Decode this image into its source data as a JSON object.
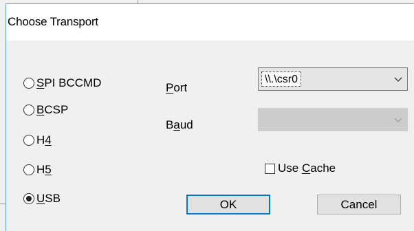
{
  "window": {
    "title": "Choose Transport"
  },
  "transport": {
    "options": [
      {
        "prefix": "",
        "accel": "S",
        "rest": "PI BCCMD",
        "checked": false
      },
      {
        "prefix": "",
        "accel": "B",
        "rest": "CSP",
        "checked": false
      },
      {
        "prefix": "H",
        "accel": "4",
        "rest": "",
        "checked": false
      },
      {
        "prefix": "H",
        "accel": "5",
        "rest": "",
        "checked": false
      },
      {
        "prefix": "",
        "accel": "U",
        "rest": "SB",
        "checked": true
      }
    ]
  },
  "port": {
    "label_accel": "P",
    "label_rest": "ort",
    "value": "\\\\.\\csr0"
  },
  "baud": {
    "label_pre": "B",
    "label_accel": "a",
    "label_rest": "ud",
    "value": ""
  },
  "use_cache": {
    "label_pre": "Use ",
    "label_accel": "C",
    "label_rest": "ache",
    "checked": false
  },
  "buttons": {
    "ok": "OK",
    "cancel": "Cancel"
  }
}
